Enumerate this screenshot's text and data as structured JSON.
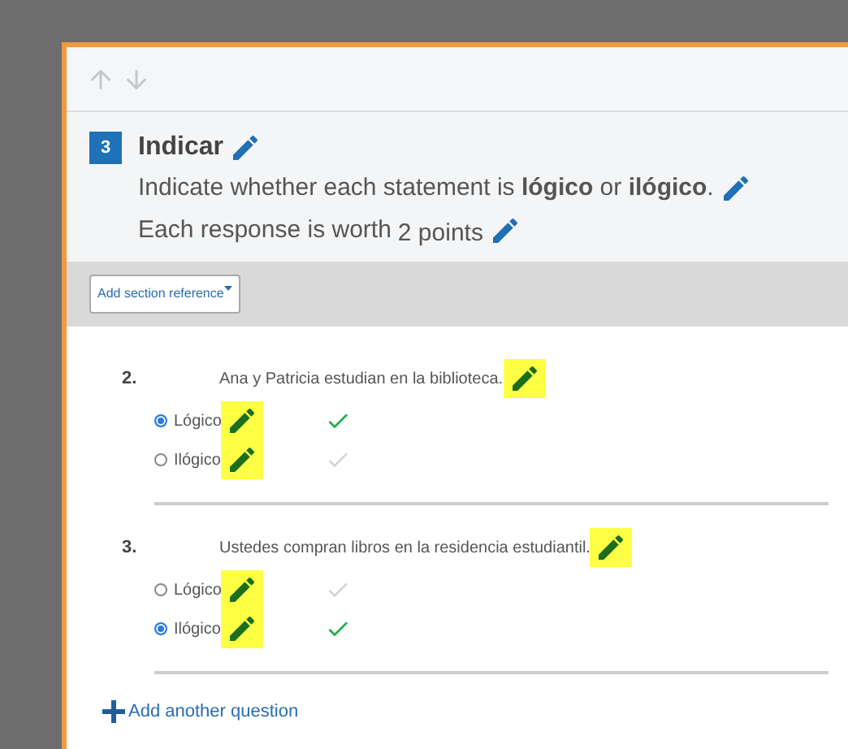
{
  "section": {
    "number": "3",
    "title": "Indicar",
    "instructions": "Indicate whether each statement is **lógico** or **ilógico**.",
    "points_prefix": "Each response is worth",
    "points": "2 points"
  },
  "reference_button": "Add section reference",
  "questions": [
    {
      "number": "2.",
      "text": "Ana y Patricia estudian en la biblioteca.",
      "options": [
        {
          "label": "Lógico",
          "selected": true,
          "correct": true
        },
        {
          "label": "Ilógico",
          "selected": false,
          "correct": false
        }
      ]
    },
    {
      "number": "3.",
      "text": "Ustedes compran libros en la residencia estudiantil.",
      "options": [
        {
          "label": "Lógico",
          "selected": false,
          "correct": false
        },
        {
          "label": "Ilógico",
          "selected": true,
          "correct": true
        }
      ]
    }
  ],
  "add_question": "Add another question"
}
